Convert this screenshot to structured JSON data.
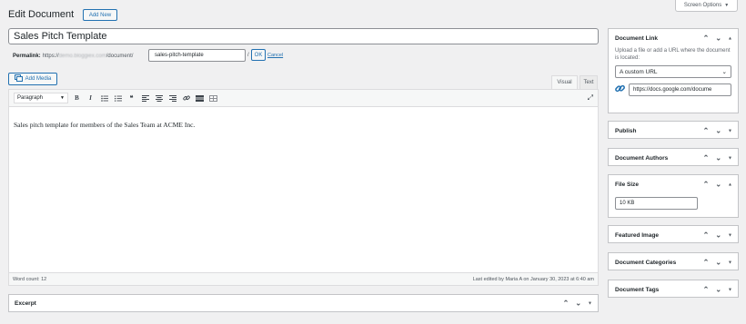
{
  "screen_options": {
    "label": "Screen Options",
    "arrow": "▼"
  },
  "header": {
    "title": "Edit Document",
    "add_new": "Add New"
  },
  "post_title": "Sales Pitch Template",
  "permalink": {
    "label": "Permalink:",
    "prefix": "https://",
    "domain_blurred": "demo.bloggiex.com",
    "path": "/document/",
    "slug": "sales-pitch-template",
    "slash": "/",
    "ok": "OK",
    "cancel": "Cancel"
  },
  "media": {
    "add_media": "Add Media"
  },
  "editor_tabs": {
    "visual": "Visual",
    "text": "Text"
  },
  "toolbar": {
    "format": "Paragraph",
    "bold": "B",
    "italic": "I",
    "bullet": "≡",
    "numbered": "≡",
    "quote": "❝",
    "align_left": "≡",
    "align_center": "≡",
    "align_right": "≡",
    "link": "🔗",
    "more": "▬",
    "kitchen": "▦",
    "expand": "⤢"
  },
  "content": "Sales pitch template for members of the Sales Team at ACME Inc.",
  "status": {
    "word_count": "Word count: 12",
    "last_edited": "Last edited by Maria A on January 30, 2023 at 6:40 am"
  },
  "excerpt": {
    "title": "Excerpt"
  },
  "sidebar": {
    "document_link": {
      "title": "Document Link",
      "desc": "Upload a file or add a URL where the document is located:",
      "select_value": "A custom URL",
      "url_value": "https://docs.google.com/docume"
    },
    "publish": {
      "title": "Publish"
    },
    "authors": {
      "title": "Document Authors"
    },
    "file_size": {
      "title": "File Size",
      "value": "10 KB"
    },
    "featured_image": {
      "title": "Featured Image"
    },
    "categories": {
      "title": "Document Categories"
    },
    "tags": {
      "title": "Document Tags"
    }
  },
  "colors": {
    "accent": "#2271b1",
    "background": "#f0f0f1"
  }
}
